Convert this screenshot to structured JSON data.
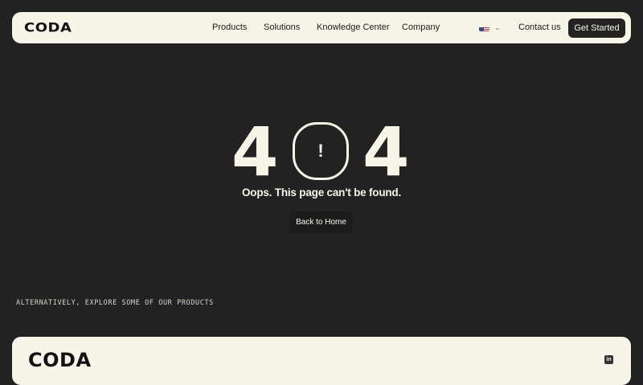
{
  "header": {
    "logo": "CODA",
    "nav": {
      "products": "Products",
      "solutions": "Solutions",
      "knowledge": "Knowledge Center",
      "company": "Company"
    },
    "language_icon": "us-flag-icon",
    "chevron": "⌄",
    "contact": "Contact us",
    "cta": "Get Started"
  },
  "error": {
    "digit_left": "4",
    "digit_center_mark": "!",
    "digit_right": "4",
    "message": "Oops. This page can't be found.",
    "back_button": "Back to Home"
  },
  "explore": {
    "label": "ALTERNATIVELY, EXPLORE SOME OF OUR PRODUCTS"
  },
  "footer": {
    "logo": "CODA",
    "social_icon": "linkedin-icon",
    "social_text": "in"
  },
  "colors": {
    "background": "#222222",
    "cream": "#f6f5e8",
    "dark_button": "#232323"
  }
}
